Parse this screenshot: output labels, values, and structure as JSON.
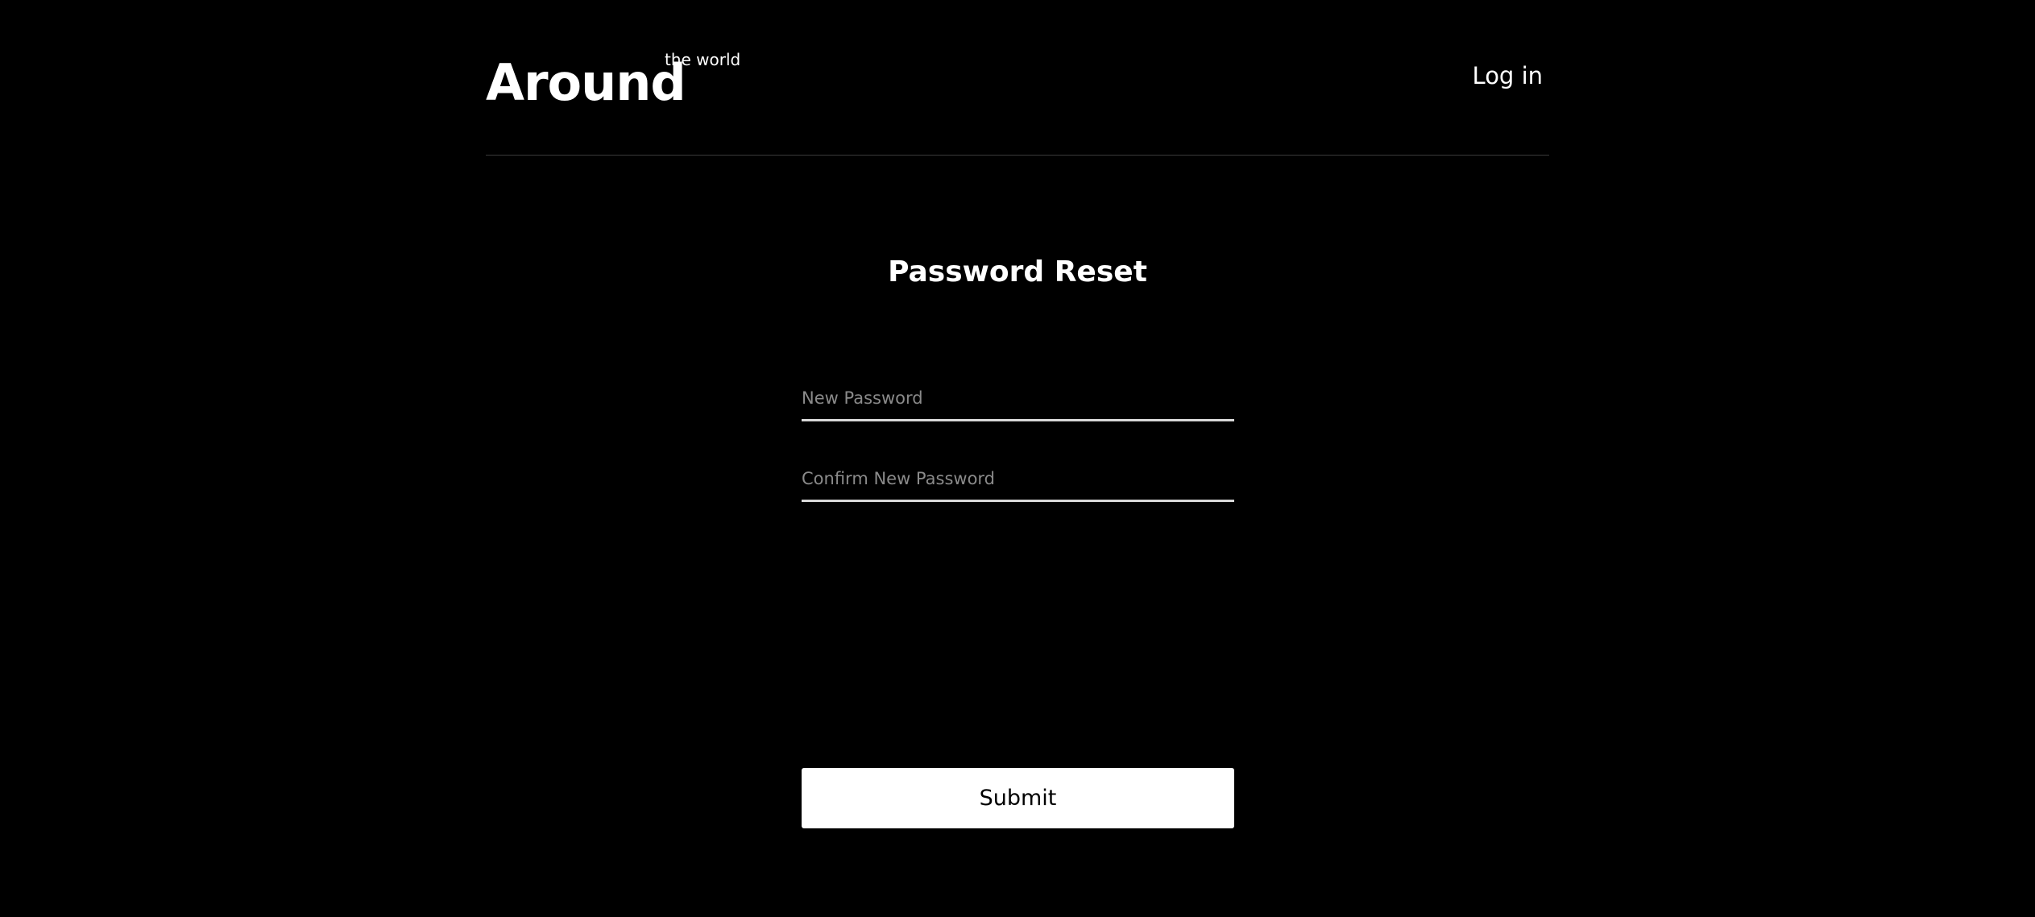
{
  "header": {
    "logo_main": "Around",
    "logo_sup": "the world",
    "login_label": "Log in"
  },
  "form": {
    "title": "Password Reset",
    "new_password": {
      "value": "",
      "placeholder": "New Password"
    },
    "confirm_password": {
      "value": "",
      "placeholder": "Confirm New Password"
    },
    "submit_label": "Submit"
  },
  "colors": {
    "background": "#000000",
    "text": "#ffffff",
    "placeholder": "#8a8a8a",
    "button_bg": "#ffffff",
    "button_text": "#000000"
  }
}
